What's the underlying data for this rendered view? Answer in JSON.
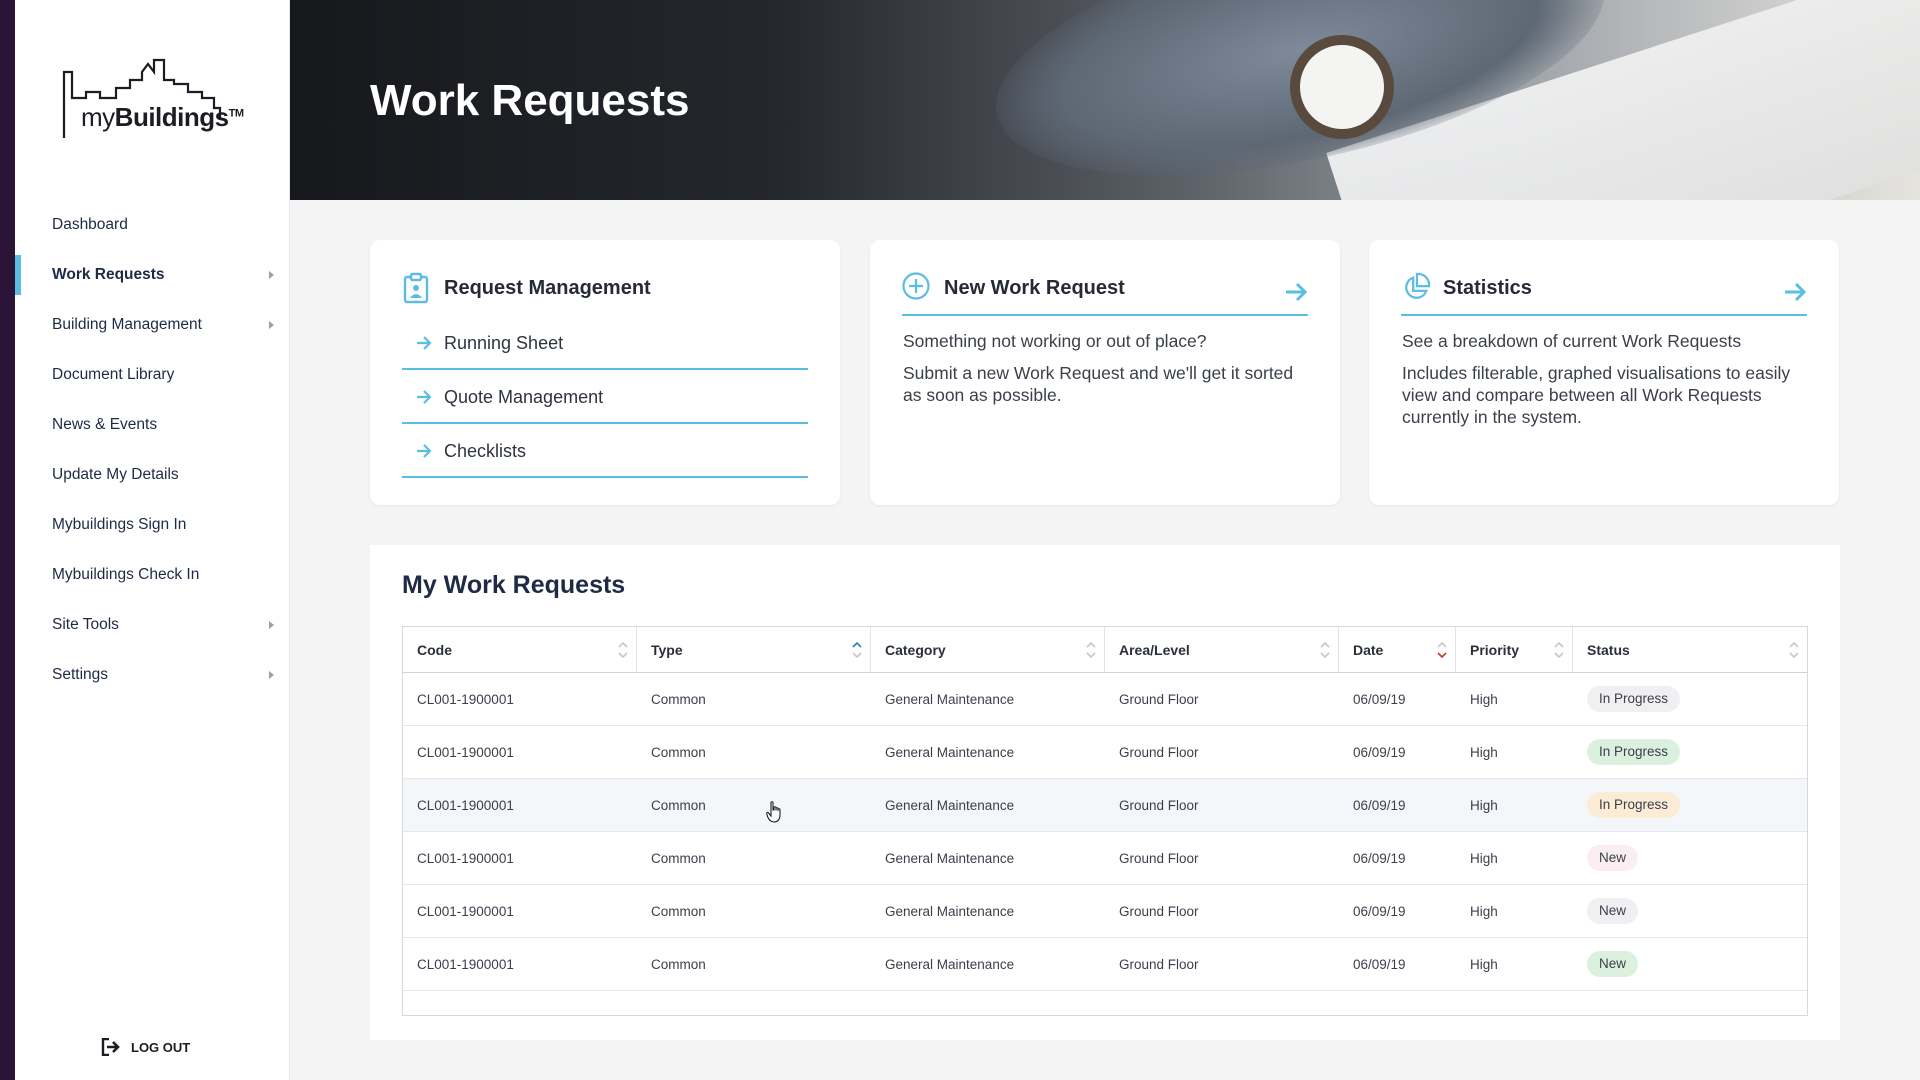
{
  "app": {
    "logo_text_regular": "my",
    "logo_text_bold": "Buildings",
    "logo_tm": "TM"
  },
  "sidebar": {
    "items": [
      {
        "label": "Dashboard",
        "active": false,
        "has_submenu": false
      },
      {
        "label": "Work Requests",
        "active": true,
        "has_submenu": true
      },
      {
        "label": "Building Management",
        "active": false,
        "has_submenu": true
      },
      {
        "label": "Document Library",
        "active": false,
        "has_submenu": false
      },
      {
        "label": "News & Events",
        "active": false,
        "has_submenu": false
      },
      {
        "label": "Update My Details",
        "active": false,
        "has_submenu": false
      },
      {
        "label": "Mybuildings Sign In",
        "active": false,
        "has_submenu": false
      },
      {
        "label": "Mybuildings Check In",
        "active": false,
        "has_submenu": false
      },
      {
        "label": "Site Tools",
        "active": false,
        "has_submenu": true
      },
      {
        "label": "Settings",
        "active": false,
        "has_submenu": true
      }
    ],
    "logout_label": "LOG OUT"
  },
  "header": {
    "title": "Work Requests"
  },
  "cards": {
    "request_management": {
      "title": "Request Management",
      "links": [
        "Running Sheet",
        "Quote Management",
        "Checklists"
      ]
    },
    "new_work_request": {
      "title": "New Work Request",
      "line1": "Something not working or out of place?",
      "line2": "Submit a new Work Request and we'll get it sorted as soon as possible."
    },
    "statistics": {
      "title": "Statistics",
      "line1": "See a breakdown of current Work Requests",
      "line2": "Includes filterable, graphed visualisations to easily view and compare between all Work Requests currently in the system."
    }
  },
  "my_work_requests": {
    "title": "My Work Requests",
    "columns": [
      "Code",
      "Type",
      "Category",
      "Area/Level",
      "Date",
      "Priority",
      "Status"
    ],
    "sort": {
      "Type": "asc",
      "Date": "desc"
    },
    "rows": [
      {
        "code": "CL001-1900001",
        "type": "Common",
        "category": "General Maintenance",
        "area": "Ground Floor",
        "date": "06/09/19",
        "priority": "High",
        "status": "In Progress",
        "status_color": "#f0f0f2"
      },
      {
        "code": "CL001-1900001",
        "type": "Common",
        "category": "General Maintenance",
        "area": "Ground Floor",
        "date": "06/09/19",
        "priority": "High",
        "status": "In Progress",
        "status_color": "#dbf1dd"
      },
      {
        "code": "CL001-1900001",
        "type": "Common",
        "category": "General Maintenance",
        "area": "Ground Floor",
        "date": "06/09/19",
        "priority": "High",
        "status": "In Progress",
        "status_color": "#fcecd6"
      },
      {
        "code": "CL001-1900001",
        "type": "Common",
        "category": "General Maintenance",
        "area": "Ground Floor",
        "date": "06/09/19",
        "priority": "High",
        "status": "New",
        "status_color": "#fbeef0"
      },
      {
        "code": "CL001-1900001",
        "type": "Common",
        "category": "General Maintenance",
        "area": "Ground Floor",
        "date": "06/09/19",
        "priority": "High",
        "status": "New",
        "status_color": "#f0f0f2"
      },
      {
        "code": "CL001-1900001",
        "type": "Common",
        "category": "General Maintenance",
        "area": "Ground Floor",
        "date": "06/09/19",
        "priority": "High",
        "status": "New",
        "status_color": "#dbf1dd"
      }
    ]
  },
  "colors": {
    "accent": "#5bbde2",
    "sort_active_asc": "#2e7fb8",
    "sort_active_desc": "#c0392b",
    "nav_text": "#1f2a44"
  }
}
